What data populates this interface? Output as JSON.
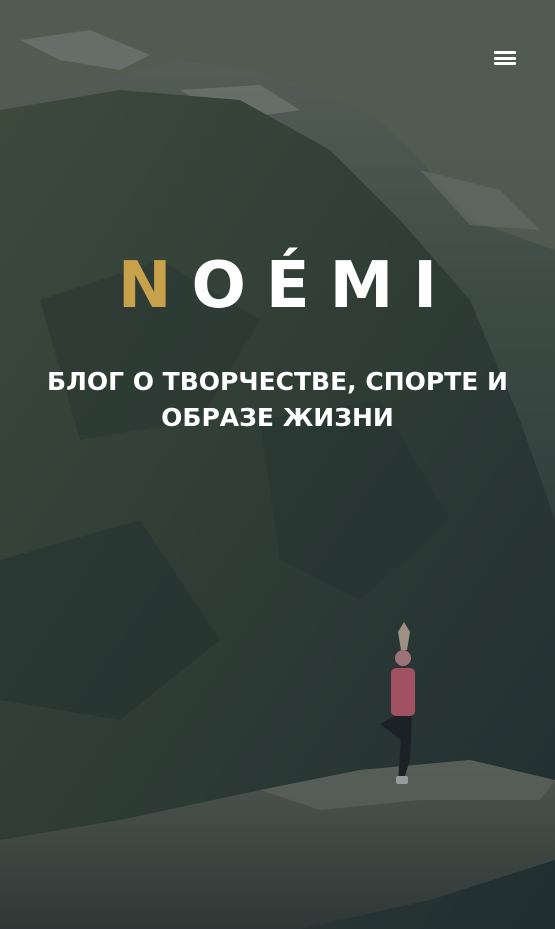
{
  "header": {
    "menu_icon": "hamburger-menu-icon"
  },
  "hero": {
    "logo_first_letter": "N",
    "logo_rest": "OÉMI",
    "tagline": "БЛОГ О ТВОРЧЕСТВЕ, СПОРТЕ И ОБРАЗЕ ЖИЗНИ",
    "background_image": "mountain cliff with person doing yoga pose",
    "accent_color": "#c8a24a",
    "text_color": "#ffffff"
  }
}
